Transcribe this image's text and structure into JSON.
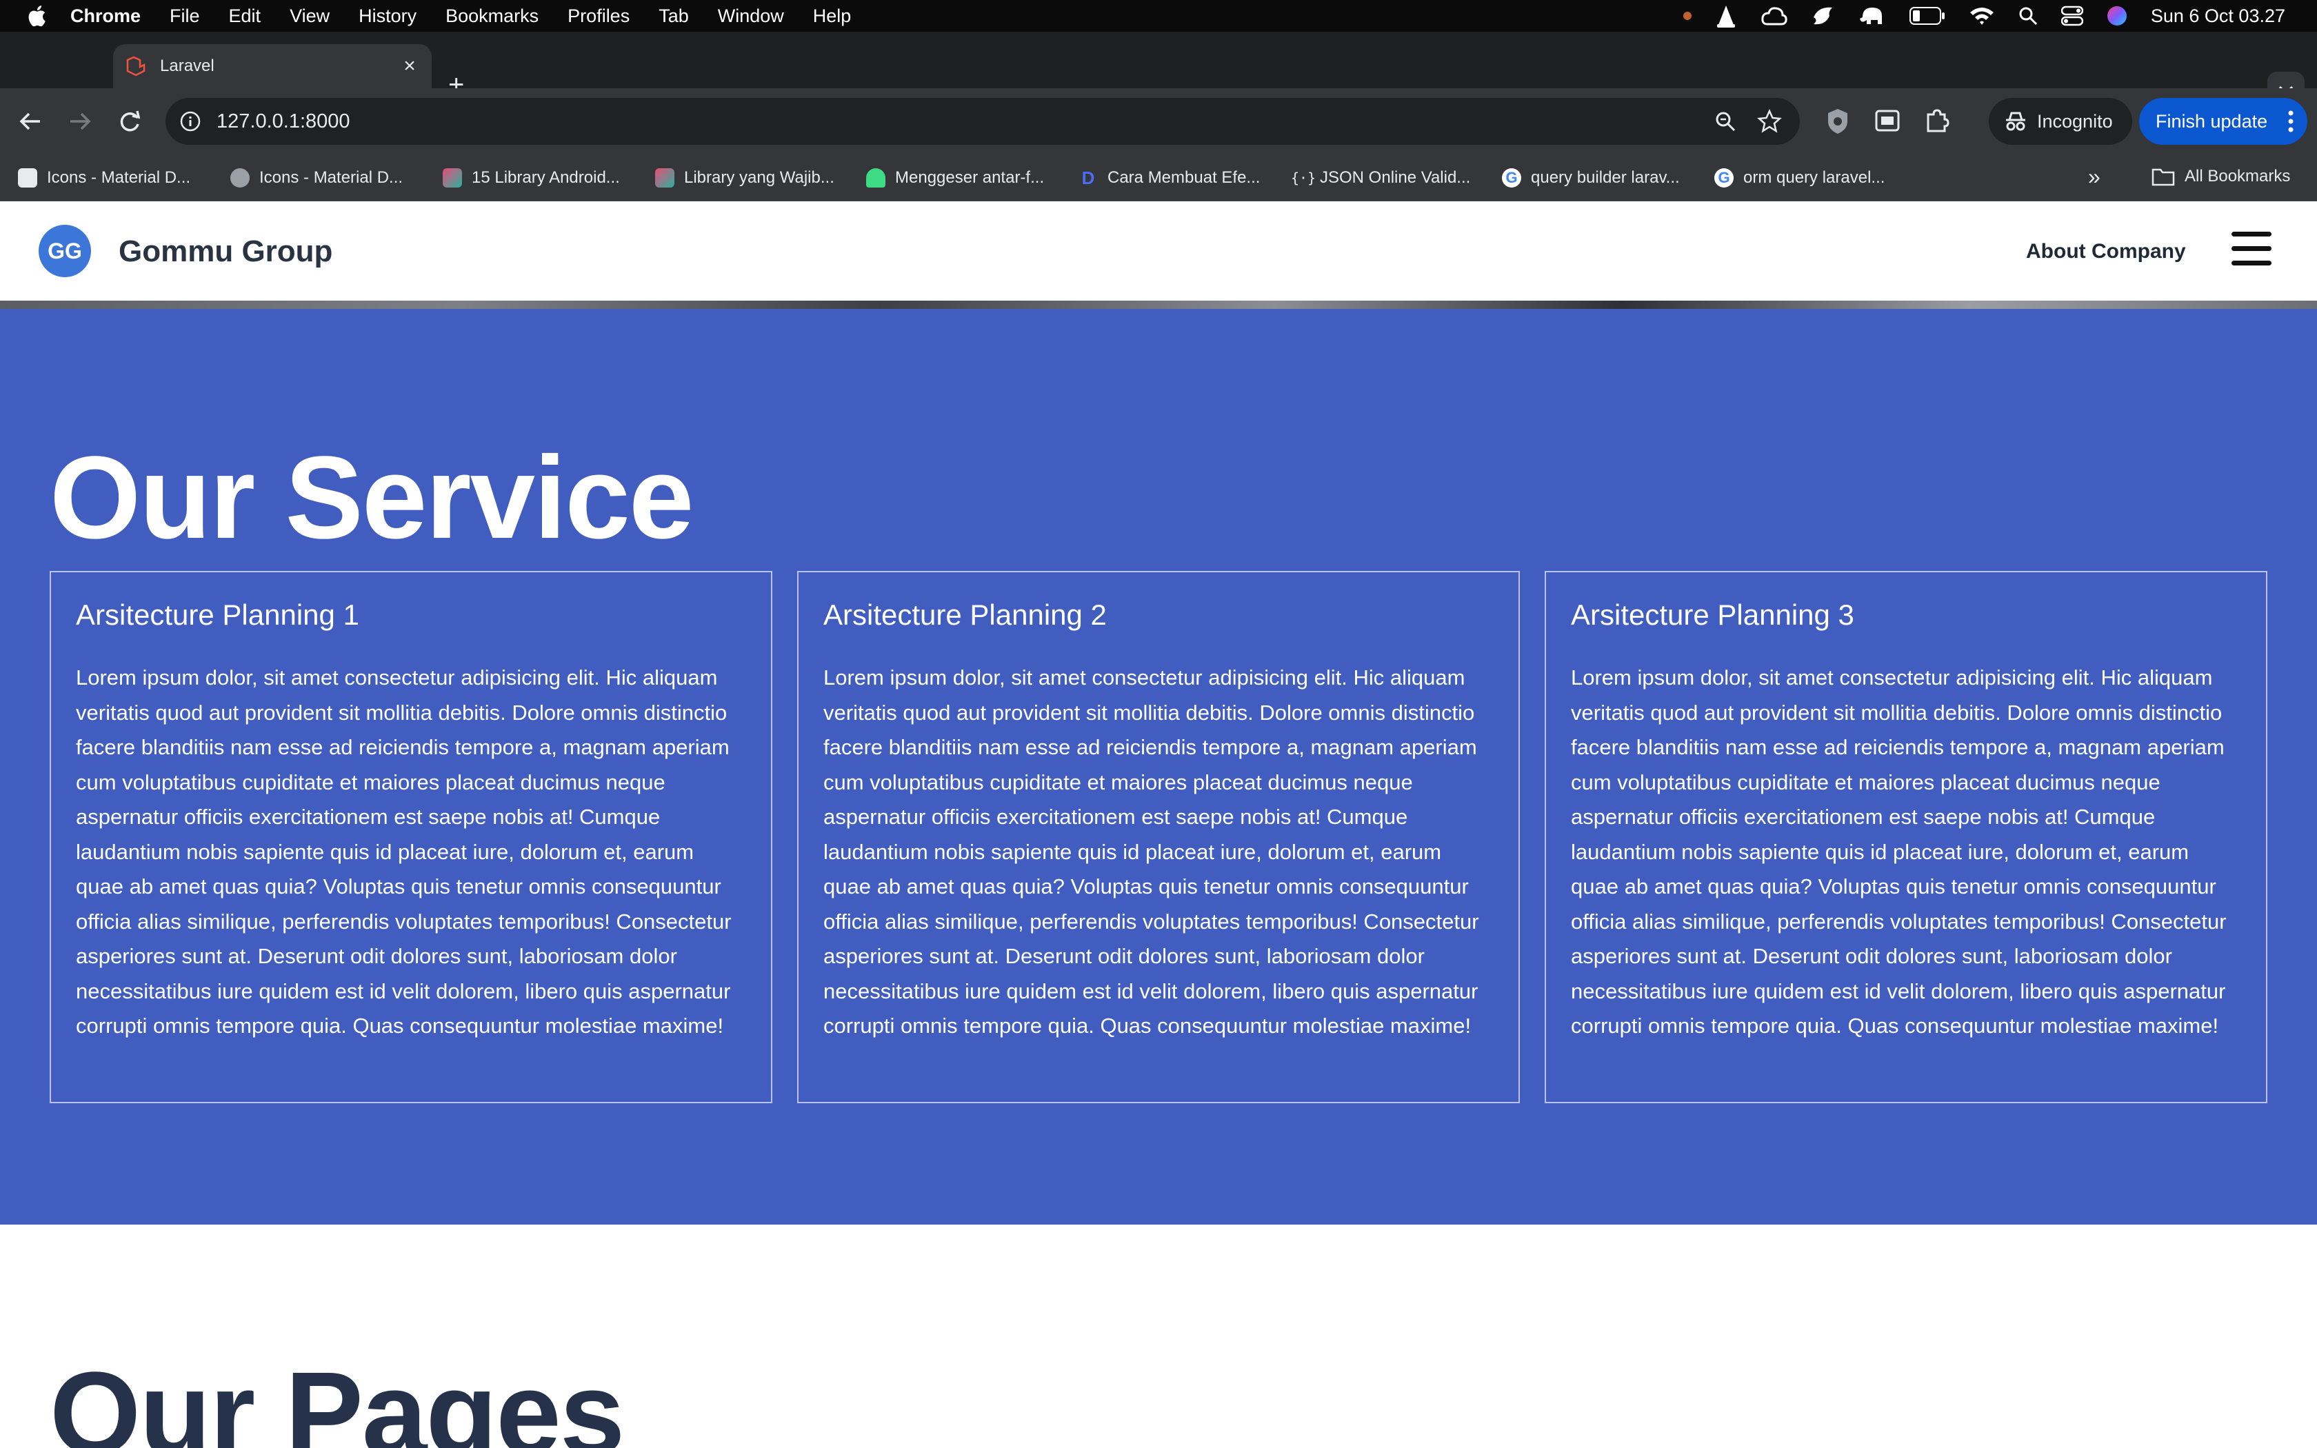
{
  "menubar": {
    "app": "Chrome",
    "items": [
      "File",
      "Edit",
      "View",
      "History",
      "Bookmarks",
      "Profiles",
      "Tab",
      "Window",
      "Help"
    ],
    "clock": "Sun 6 Oct  03.27"
  },
  "tab": {
    "title": "Laravel"
  },
  "toolbar": {
    "url": "127.0.0.1:8000",
    "incognito_label": "Incognito",
    "finish_update_label": "Finish update"
  },
  "bookmarks": {
    "items": [
      "Icons - Material D...",
      "Icons - Material D...",
      "15 Library Android...",
      "Library yang Wajib...",
      "Menggeser antar-f...",
      "Cara Membuat Efe...",
      "JSON Online Valid...",
      "query builder larav...",
      "orm query laravel..."
    ],
    "all_label": "All Bookmarks"
  },
  "site": {
    "logo_initials": "GG",
    "brand": "Gommu Group",
    "nav_link": "About Company",
    "service_title": "Our Service",
    "cards": [
      {
        "title": "Arsitecture Planning 1",
        "body": "Lorem ipsum dolor, sit amet consectetur adipisicing elit. Hic aliquam veritatis quod aut provident sit mollitia debitis. Dolore omnis distinctio facere blanditiis nam esse ad reiciendis tempore a, magnam aperiam cum voluptatibus cupiditate et maiores placeat ducimus neque aspernatur officiis exercitationem est saepe nobis at! Cumque laudantium nobis sapiente quis id placeat iure, dolorum et, earum quae ab amet quas quia? Voluptas quis tenetur omnis consequuntur officia alias similique, perferendis voluptates temporibus! Consectetur asperiores sunt at. Deserunt odit dolores sunt, laboriosam dolor necessitatibus iure quidem est id velit dolorem, libero quis aspernatur corrupti omnis tempore quia. Quas consequuntur molestiae maxime!"
      },
      {
        "title": "Arsitecture Planning 2",
        "body": "Lorem ipsum dolor, sit amet consectetur adipisicing elit. Hic aliquam veritatis quod aut provident sit mollitia debitis. Dolore omnis distinctio facere blanditiis nam esse ad reiciendis tempore a, magnam aperiam cum voluptatibus cupiditate et maiores placeat ducimus neque aspernatur officiis exercitationem est saepe nobis at! Cumque laudantium nobis sapiente quis id placeat iure, dolorum et, earum quae ab amet quas quia? Voluptas quis tenetur omnis consequuntur officia alias similique, perferendis voluptates temporibus! Consectetur asperiores sunt at. Deserunt odit dolores sunt, laboriosam dolor necessitatibus iure quidem est id velit dolorem, libero quis aspernatur corrupti omnis tempore quia. Quas consequuntur molestiae maxime!"
      },
      {
        "title": "Arsitecture Planning 3",
        "body": "Lorem ipsum dolor, sit amet consectetur adipisicing elit. Hic aliquam veritatis quod aut provident sit mollitia debitis. Dolore omnis distinctio facere blanditiis nam esse ad reiciendis tempore a, magnam aperiam cum voluptatibus cupiditate et maiores placeat ducimus neque aspernatur officiis exercitationem est saepe nobis at! Cumque laudantium nobis sapiente quis id placeat iure, dolorum et, earum quae ab amet quas quia? Voluptas quis tenetur omnis consequuntur officia alias similique, perferendis voluptates temporibus! Consectetur asperiores sunt at. Deserunt odit dolores sunt, laboriosam dolor necessitatibus iure quidem est id velit dolorem, libero quis aspernatur corrupti omnis tempore quia. Quas consequuntur molestiae maxime!"
      }
    ],
    "pages_title": "Our Pages"
  },
  "colors": {
    "service_bg": "#415dbf",
    "logo_bg": "#3b76d8",
    "finish_update_bg": "#0b57d0",
    "chrome_toolbar": "#35363a"
  }
}
